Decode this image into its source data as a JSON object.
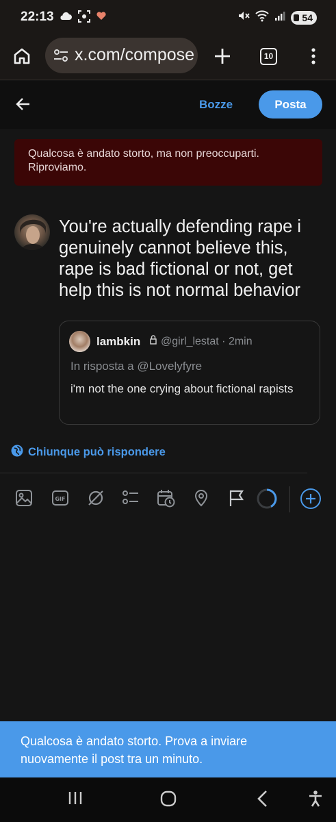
{
  "status_bar": {
    "time": "22:13",
    "battery": "54",
    "icons": [
      "cloud-icon",
      "screenshot-icon",
      "heart-icon",
      "mute-icon",
      "wifi-icon",
      "signal-icon",
      "battery-icon"
    ]
  },
  "browser": {
    "url": "x.com/compose",
    "tab_count": "10"
  },
  "compose": {
    "drafts_label": "Bozze",
    "post_label": "Posta",
    "error_banner": "Qualcosa è andato storto, ma non preoccuparti. Riproviamo.",
    "tweet_text": "You're actually defending rape i genuinely cannot believe this, rape is bad fictional or not, get help this is not normal behavior",
    "reply_setting": "Chiunque può rispondere"
  },
  "quote": {
    "name": "lambkin",
    "handle_time": "@girl_lestat · 2min",
    "reply_to": "In risposta a @Lovelyfyre",
    "text": "i'm not the one crying about fictional rapists"
  },
  "toolbar": {
    "tools": [
      "image-icon",
      "gif-icon",
      "grok-icon",
      "poll-icon",
      "schedule-icon",
      "location-icon",
      "flag-icon",
      "progress-ring-icon",
      "add-thread-icon"
    ]
  },
  "toast": {
    "text": "Qualcosa è andato storto. Prova a inviare nuovamente il post tra un minuto."
  },
  "colors": {
    "accent": "#4a99e9",
    "error_bg": "#3b0606",
    "background": "#151515"
  }
}
